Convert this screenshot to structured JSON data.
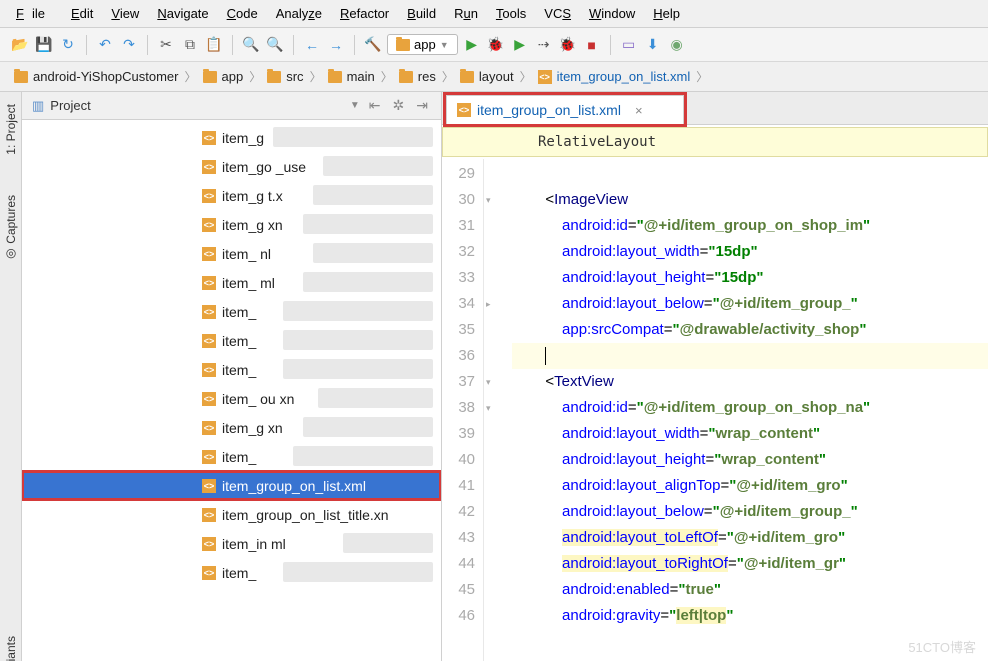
{
  "menu": {
    "file": "File",
    "edit": "Edit",
    "view": "View",
    "navigate": "Navigate",
    "code": "Code",
    "analyze": "Analyze",
    "refactor": "Refactor",
    "build": "Build",
    "run": "Run",
    "tools": "Tools",
    "vcs": "VCS",
    "window": "Window",
    "help": "Help"
  },
  "toolbar": {
    "run_target": "app"
  },
  "breadcrumb": {
    "p0": "android-YiShopCustomer",
    "p1": "app",
    "p2": "src",
    "p3": "main",
    "p4": "res",
    "p5": "layout",
    "file": "item_group_on_list.xml"
  },
  "project_panel": {
    "title": "Project"
  },
  "rail": {
    "project": "1: Project",
    "captures": "Captures",
    "variants": "iants"
  },
  "tree": [
    {
      "name": "item_g",
      "obs": 160
    },
    {
      "name": "item_go",
      "suffix": "_use",
      "obs": 110
    },
    {
      "name": "item_g",
      "suffix": "t.x",
      "obs": 120
    },
    {
      "name": "item_g",
      "suffix": "xn",
      "obs": 130
    },
    {
      "name": "item_",
      "suffix": "nl",
      "obs": 120
    },
    {
      "name": "item_",
      "suffix": "ml",
      "obs": 130
    },
    {
      "name": "item_",
      "suffix": "",
      "obs": 150
    },
    {
      "name": "item_",
      "suffix": "",
      "obs": 150
    },
    {
      "name": "item_",
      "suffix": "",
      "obs": 150
    },
    {
      "name": "item_  ou",
      "suffix": "xn",
      "obs": 115
    },
    {
      "name": "item_g",
      "suffix": "xn",
      "obs": 130
    },
    {
      "name": "item_",
      "suffix": "",
      "obs": 140
    },
    {
      "name": "item_group_on_list.xml",
      "sel": true,
      "hl": true
    },
    {
      "name": "item_group_on_list_title.xn",
      "obs": 0
    },
    {
      "name": "item_in",
      "suffix": "ml",
      "obs": 90
    },
    {
      "name": "item_",
      "suffix": "",
      "obs": 150
    }
  ],
  "tab": {
    "name": "item_group_on_list.xml"
  },
  "crumb2": "RelativeLayout",
  "gutter_start": 29,
  "code": [
    {
      "n": 29,
      "t": ""
    },
    {
      "n": 30,
      "t": "        <ImageView",
      "tag": "ImageView"
    },
    {
      "n": 31,
      "t": "            android:id=\"@+id/item_group_on_shop_im",
      "a": "id",
      "v": "@+id/item_group_on_shop_im"
    },
    {
      "n": 32,
      "t": "            android:layout_width=\"15dp\"",
      "a": "layout_width",
      "v": "15dp"
    },
    {
      "n": 33,
      "t": "            android:layout_height=\"15dp\"",
      "a": "layout_height",
      "v": "15dp"
    },
    {
      "n": 34,
      "t": "            android:layout_below=\"@+id/item_group_",
      "a": "layout_below",
      "v": "@+id/item_group_"
    },
    {
      "n": 35,
      "t": "            app:srcCompat=\"@drawable/activity_shop",
      "ns": "app",
      "a": "srcCompat",
      "v": "@drawable/activity_shop"
    },
    {
      "n": 36,
      "cur": true
    },
    {
      "n": 37,
      "t": "        <TextView",
      "tag": "TextView"
    },
    {
      "n": 38,
      "t": "            android:id=\"@+id/item_group_on_shop_na",
      "a": "id",
      "v": "@+id/item_group_on_shop_na"
    },
    {
      "n": 39,
      "t": "            android:layout_width=\"wrap_content\"",
      "a": "layout_width",
      "v": "wrap_content"
    },
    {
      "n": 40,
      "t": "            android:layout_height=\"wrap_content\"",
      "a": "layout_height",
      "v": "wrap_content"
    },
    {
      "n": 41,
      "t": "            android:layout_alignTop=\"@+id/item_gro",
      "a": "layout_alignTop",
      "v": "@+id/item_gro"
    },
    {
      "n": 42,
      "t": "            android:layout_below=\"@+id/item_group_",
      "a": "layout_below",
      "v": "@+id/item_group_"
    },
    {
      "n": 43,
      "hly": true,
      "a": "layout_toLeftOf",
      "v": "@+id/item_gro"
    },
    {
      "n": 44,
      "hly": true,
      "a": "layout_toRightOf",
      "v": "@+id/item_gr"
    },
    {
      "n": 45,
      "t": "            android:enabled=\"true\"",
      "a": "enabled",
      "v": "true"
    },
    {
      "n": 46,
      "t": "            android:gravity=\"left|top\"",
      "a": "gravity",
      "v": "left|top",
      "hlv": true
    }
  ],
  "watermark": "51CTO博客"
}
